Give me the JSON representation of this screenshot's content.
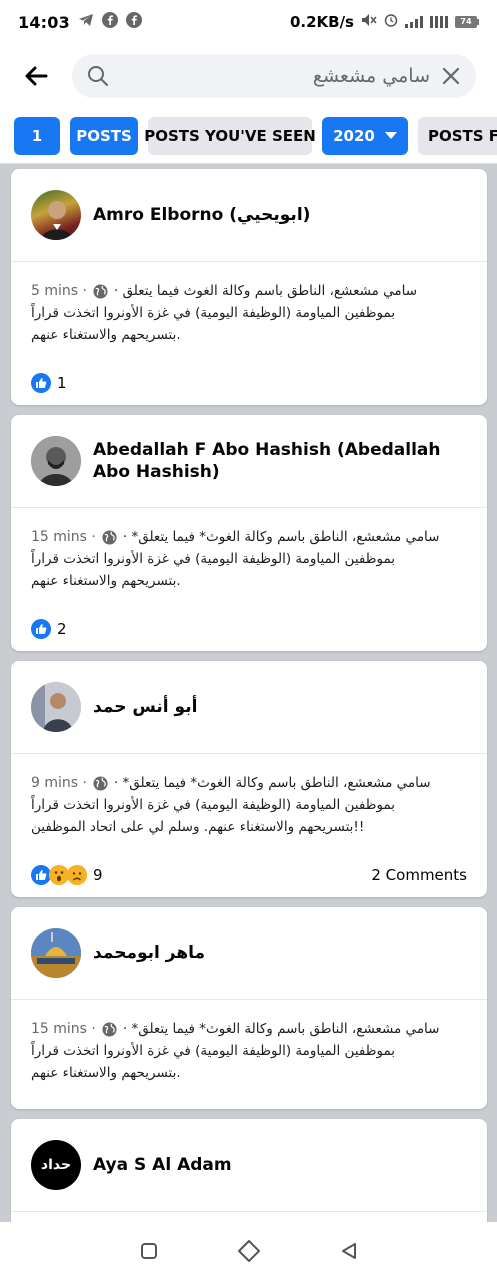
{
  "status": {
    "time": "14:03",
    "net_speed": "0.2KB/s",
    "battery": "74"
  },
  "search": {
    "query": "سامي مشعشع"
  },
  "filters": {
    "count": "1",
    "posts": "POSTS",
    "posts_seen": "POSTS YOU'VE SEEN",
    "year": "2020",
    "posts_from": "POSTS FR"
  },
  "posts": [
    {
      "author": "Amro Elborno (ابويحيي)",
      "line1": "سامي مشعشع، الناطق باسم وكالة الغوث فيما يتعلق ·",
      "time": "5 mins ·",
      "line2": "بموظفين المياومة (الوظيفة اليومية) في غزة الأونروا اتخذت قراراً",
      "line3": ".بتسريحهم والاستغناء عنهم",
      "reactions": "1"
    },
    {
      "author": "Abedallah F Abo Hashish (Abedallah Abo Hashish)",
      "line1": "سامي مشعشع، الناطق باسم وكالة الغوث* فيما يتعلق* ·",
      "time": "15 mins ·",
      "line2": "بموظفين المياومة (الوظيفة اليومية) في غزة الأونروا اتخذت قراراً",
      "line3": ".بتسريحهم والاستغناء عنهم",
      "reactions": "2"
    },
    {
      "author": "أبو أنس حمد",
      "line1": "سامي مشعشع، الناطق باسم وكالة الغوث* فيما يتعلق* ·",
      "time": "9 mins ·",
      "line2": "بموظفين المياومة (الوظيفة اليومية) في غزة الأونروا اتخذت قراراً",
      "line3": "!!بتسريحهم والاستغناء عنهم. وسلم لي على اتحاد الموظفين",
      "reactions": "9",
      "comments": "2 Comments"
    },
    {
      "author": "ماهر ابومحمد",
      "line1": "سامي مشعشع، الناطق باسم وكالة الغوث* فيما يتعلق* ·",
      "time": "15 mins ·",
      "line2": "بموظفين المياومة (الوظيفة اليومية) في غزة الأونروا اتخذت قراراً",
      "line3": ".بتسريحهم والاستغناء عنهم"
    },
    {
      "author": "Aya S Al Adam",
      "avatar_text": "حداد"
    }
  ],
  "colors": {
    "accent": "#1877f2",
    "chip_gray": "#e4e6eb",
    "feed_bg": "#c9ccd1"
  }
}
